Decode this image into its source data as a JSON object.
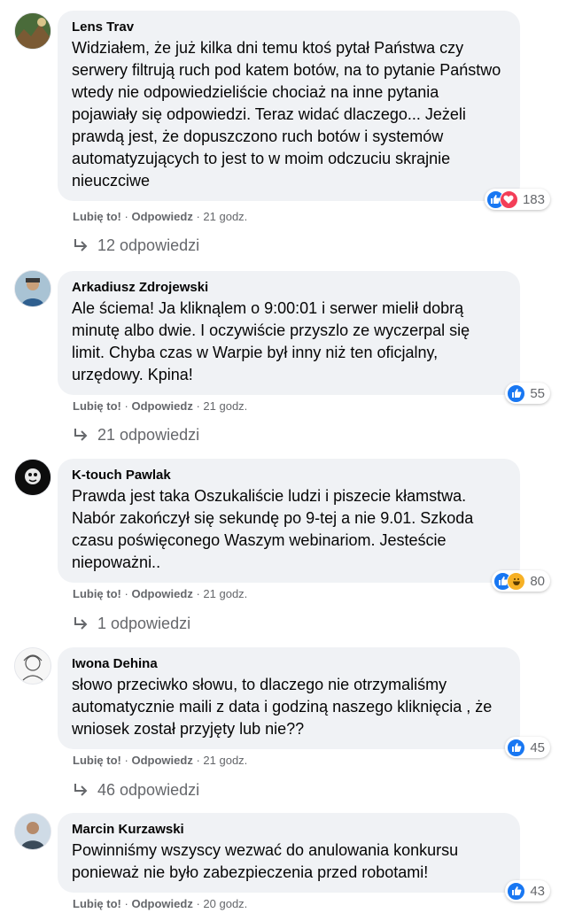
{
  "actions": {
    "like": "Lubię to!",
    "reply": "Odpowiedz",
    "sep": "·"
  },
  "colors": {
    "like": "#1877f2",
    "love": "#f33e58",
    "haha": "#f7b125",
    "bubble": "#f0f2f5",
    "meta": "#65676b"
  },
  "comments": [
    {
      "author": "Lens Trav",
      "avatar_icon": "user-avatar",
      "text": "Widziałem, że już kilka dni temu ktoś pytał Państwa czy serwery filtrują ruch pod katem botów, na to pytanie Państwo wtedy nie odpowiedzieliście chociaż na inne pytania pojawiały się odpowiedzi. Teraz widać dlaczego... Jeżeli prawdą jest, że dopuszczono ruch botów i systemów automatyzujących to jest to w moim odczuciu skrajnie nieuczciwe",
      "time": "21 godz.",
      "reaction_icons": [
        "like-icon",
        "love-icon"
      ],
      "reaction_count": "183",
      "replies": "12 odpowiedzi"
    },
    {
      "author": "Arkadiusz Zdrojewski",
      "avatar_icon": "user-avatar",
      "text": "Ale ściema! Ja kliknąlem o 9:00:01 i serwer mielił dobrą minutę albo dwie. I oczywiście przyszlo ze wyczerpal się limit. Chyba czas w Warpie był inny niż ten oficjalny, urzędowy. Kpina!",
      "time": "21 godz.",
      "reaction_icons": [
        "like-icon"
      ],
      "reaction_count": "55",
      "replies": "21 odpowiedzi"
    },
    {
      "author": "K-touch Pawlak",
      "avatar_icon": "user-avatar",
      "text": "Prawda jest taka Oszukaliście ludzi i piszecie kłamstwa. Nabór zakończył się sekundę po 9-tej a nie 9.01. Szkoda czasu poświęconego Waszym webinariom. Jesteście niepoważni..",
      "time": "21 godz.",
      "reaction_icons": [
        "like-icon",
        "haha-icon"
      ],
      "reaction_count": "80",
      "replies": "1 odpowiedzi"
    },
    {
      "author": "Iwona Dehina",
      "avatar_icon": "user-avatar",
      "text": "słowo przeciwko słowu, to dlaczego nie otrzymaliśmy automatycznie maili z data i godziną naszego kliknięcia , że wniosek został przyjęty lub nie??",
      "time": "21 godz.",
      "reaction_icons": [
        "like-icon"
      ],
      "reaction_count": "45",
      "replies": "46 odpowiedzi"
    },
    {
      "author": "Marcin Kurzawski",
      "avatar_icon": "user-avatar",
      "text": "Powinniśmy wszyscy wezwać do anulowania konkursu ponieważ nie było zabezpieczenia przed robotami!",
      "time": "20 godz.",
      "reaction_icons": [
        "like-icon"
      ],
      "reaction_count": "43",
      "replies": ""
    }
  ]
}
